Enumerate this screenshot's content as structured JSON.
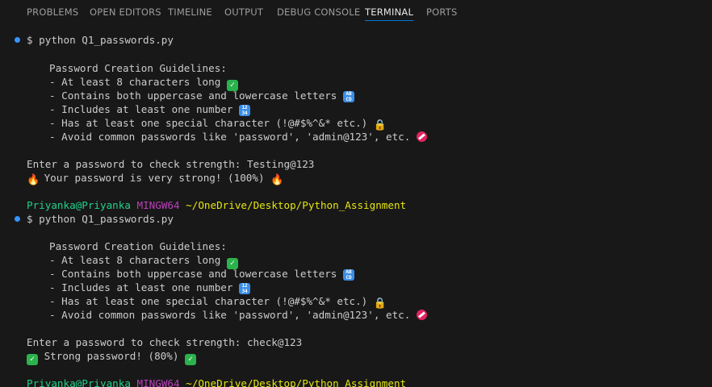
{
  "panel_tabs": [
    {
      "label": "PROBLEMS",
      "active": false
    },
    {
      "label": "OPEN EDITORS",
      "active": false
    },
    {
      "label": "TIMELINE",
      "active": false
    },
    {
      "label": "OUTPUT",
      "active": false
    },
    {
      "label": "DEBUG CONSOLE",
      "active": false
    },
    {
      "label": "TERMINAL",
      "active": true
    },
    {
      "label": "PORTS",
      "active": false
    }
  ],
  "terminal": {
    "run1": {
      "command": "$ python Q1_passwords.py",
      "guidelines_title": "Password Creation Guidelines:",
      "g1": "- At least 8 characters long",
      "g2": "- Contains both uppercase and lowercase letters",
      "g3": "- Includes at least one number",
      "g4": "- Has at least one special character (!@#$%^&* etc.)",
      "g5": "- Avoid common passwords like 'password', 'admin@123', etc.",
      "prompt": "Enter a password to check strength: Testing@123",
      "result": "Your password is very strong! (100%)"
    },
    "prompt1": {
      "user": "Priyanka@Priyanka",
      "env": "MINGW64",
      "path": "~/OneDrive/Desktop/Python_Assignment"
    },
    "run2": {
      "command": "$ python Q1_passwords.py",
      "guidelines_title": "Password Creation Guidelines:",
      "g1": "- At least 8 characters long",
      "g2": "- Contains both uppercase and lowercase letters",
      "g3": "- Includes at least one number",
      "g4": "- Has at least one special character (!@#$%^&* etc.)",
      "g5": "- Avoid common passwords like 'password', 'admin@123', etc.",
      "prompt": "Enter a password to check strength: check@123",
      "result": "Strong password! (80%)"
    },
    "prompt2": {
      "user": "Priyanka@Priyanka",
      "env": "MINGW64",
      "path": "~/OneDrive/Desktop/Python_Assignment"
    }
  },
  "colors": {
    "background": "#181818",
    "prompt_user": "#23d18b",
    "prompt_env": "#bc3fbc",
    "prompt_path": "#e5e510",
    "active_tab_underline": "#0078d4",
    "command_dot": "#3794ff"
  },
  "icons": {
    "g1": "check-mark-icon",
    "g2": "abcd-letters-icon",
    "g3": "numbers-icon",
    "g4": "lock-icon",
    "g5": "no-entry-icon",
    "result1": "fire-icon",
    "result2": "check-mark-icon"
  }
}
